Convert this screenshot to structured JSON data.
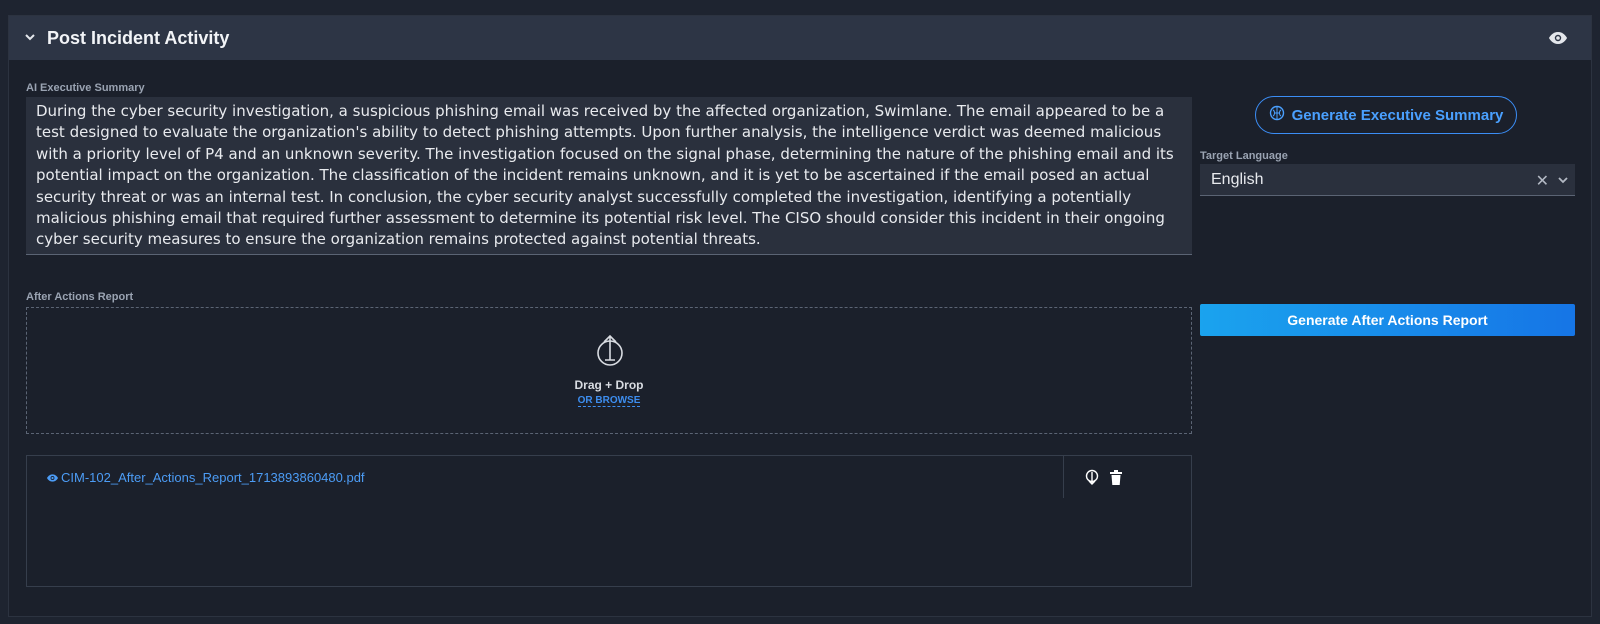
{
  "panel": {
    "title": "Post Incident Activity"
  },
  "summary": {
    "label": "AI Executive Summary",
    "text": "During the cyber security investigation, a suspicious phishing email was received by the affected organization, Swimlane. The email appeared to be a test designed to evaluate the organization's ability to detect phishing attempts. Upon further analysis, the intelligence verdict was deemed malicious with a priority level of P4 and an unknown severity. The investigation focused on the signal phase, determining the nature of the phishing email and its potential impact on the organization. The classification of the incident remains unknown, and it is yet to be ascertained if the email posed an actual security threat or was an internal test. In conclusion, the cyber security analyst successfully completed the investigation, identifying a potentially malicious phishing email that required further assessment to determine its potential risk level. The CISO should consider this incident in their ongoing cyber security measures to ensure the organization remains protected against potential threats."
  },
  "actions": {
    "generate_summary_label": "Generate Executive Summary",
    "generate_report_label": "Generate After Actions Report"
  },
  "language": {
    "label": "Target Language",
    "value": "English"
  },
  "report": {
    "label": "After Actions Report",
    "drag_drop": "Drag + Drop",
    "browse": "OR BROWSE",
    "files": [
      {
        "name": "CIM-102_After_Actions_Report_1713893860480.pdf"
      }
    ]
  },
  "icons": {
    "collapse": "chevron-down-icon",
    "visibility": "eye-icon",
    "ai": "brain-icon",
    "clear": "close-icon",
    "dropdown": "chevron-down-icon",
    "upload": "upload-icon",
    "file_view": "eye-icon",
    "file_download": "download-icon",
    "file_delete": "trash-icon"
  },
  "colors": {
    "accent": "#3b8df5",
    "header_bg": "#2d3545",
    "panel_bg": "#1b202b",
    "button_gradient_start": "#1aa3ee",
    "button_gradient_end": "#1675e6"
  }
}
